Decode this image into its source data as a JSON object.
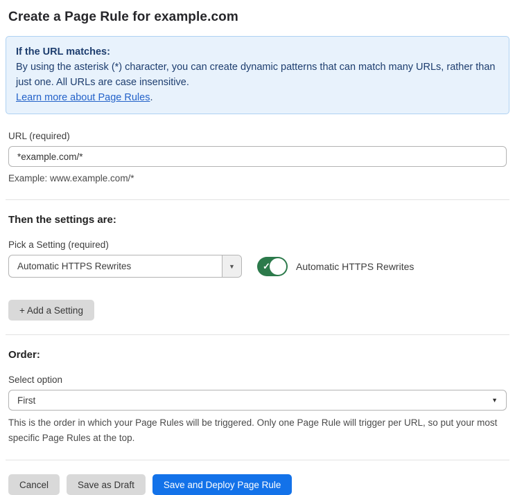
{
  "page": {
    "title": "Create a Page Rule for example.com"
  },
  "info_box": {
    "heading": "If the URL matches:",
    "body": "By using the asterisk (*) character, you can create dynamic patterns that can match many URLs, rather than just one. All URLs are case insensitive.",
    "link_label": "Learn more about Page Rules",
    "link_suffix": "."
  },
  "url_field": {
    "label": "URL (required)",
    "value": "*example.com/*",
    "helper": "Example: www.example.com/*"
  },
  "settings_section": {
    "heading": "Then the settings are:",
    "picker_label": "Pick a Setting (required)",
    "selected_setting": "Automatic HTTPS Rewrites",
    "toggle_state": "on",
    "toggle_label": "Automatic HTTPS Rewrites",
    "add_setting_label": "+ Add a Setting"
  },
  "order_section": {
    "heading": "Order:",
    "select_label": "Select option",
    "selected_option": "First",
    "helper": "This is the order in which your Page Rules will be triggered. Only one Page Rule will trigger per URL, so put your most specific Page Rules at the top."
  },
  "footer": {
    "cancel_label": "Cancel",
    "save_draft_label": "Save as Draft",
    "save_deploy_label": "Save and Deploy Page Rule"
  },
  "icons": {
    "dropdown_arrow": "▼",
    "checkmark": "✓"
  },
  "colors": {
    "accent_blue": "#1372e9",
    "info_background": "#e8f2fc",
    "info_border": "#aed1f2",
    "info_text": "#1d3d6e",
    "link_blue": "#2362c9",
    "toggle_green": "#2c7a4b",
    "button_gray": "#d9d9d9"
  }
}
